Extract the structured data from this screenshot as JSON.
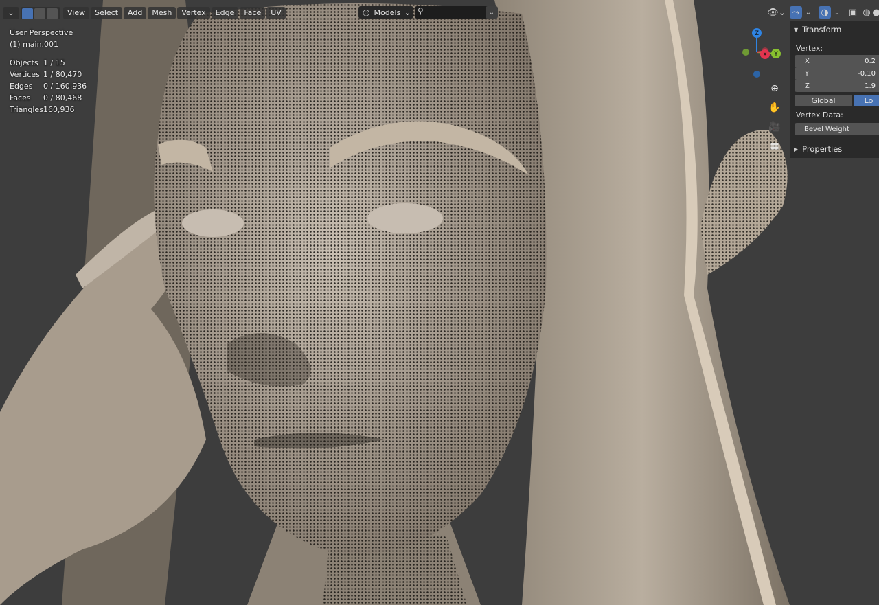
{
  "header": {
    "menus": [
      "View",
      "Select",
      "Add",
      "Mesh",
      "Vertex",
      "Edge",
      "Face",
      "UV"
    ],
    "collection_dropdown": "Models",
    "icons": [
      "mode-dropdown-chevron-icon",
      "vertex-select-icon",
      "edge-select-icon",
      "face-select-icon",
      "collection-icon",
      "search-icon",
      "visibility-icon",
      "snapping-icon",
      "overlay-icon",
      "xray-icon",
      "shading-wire-icon",
      "shading-solid-icon"
    ]
  },
  "overlay": {
    "perspective": "User Perspective",
    "object_name": "(1) main.001",
    "stats": [
      {
        "label": "Objects",
        "value": "1 / 15"
      },
      {
        "label": "Vertices",
        "value": "1 / 80,470"
      },
      {
        "label": "Edges",
        "value": "0 / 160,936"
      },
      {
        "label": "Faces",
        "value": "0 / 80,468"
      },
      {
        "label": "Triangles",
        "value": "160,936"
      }
    ]
  },
  "gizmo": {
    "axes": [
      "Z",
      "X",
      "Y"
    ],
    "colors": {
      "x": "#e2344f",
      "y": "#88c130",
      "z": "#2f84e3"
    }
  },
  "nav_buttons": [
    "zoom-icon",
    "hand-icon",
    "camera-icon",
    "grid-icon"
  ],
  "npanel": {
    "transform_title": "Transform",
    "vertex_label": "Vertex:",
    "fields": [
      {
        "label": "X",
        "value": "0.2"
      },
      {
        "label": "Y",
        "value": "-0.10"
      },
      {
        "label": "Z",
        "value": "1.9"
      }
    ],
    "space_toggle": {
      "global": "Global",
      "local": "Lo",
      "active": "local"
    },
    "vertex_data_label": "Vertex Data:",
    "bevel_weight_label": "Bevel Weight",
    "properties_title": "Properties"
  },
  "colors": {
    "accent": "#4772b3",
    "header_bg": "#303030",
    "panel_bg": "#282828",
    "sculpt_clay": "#b1a595"
  }
}
